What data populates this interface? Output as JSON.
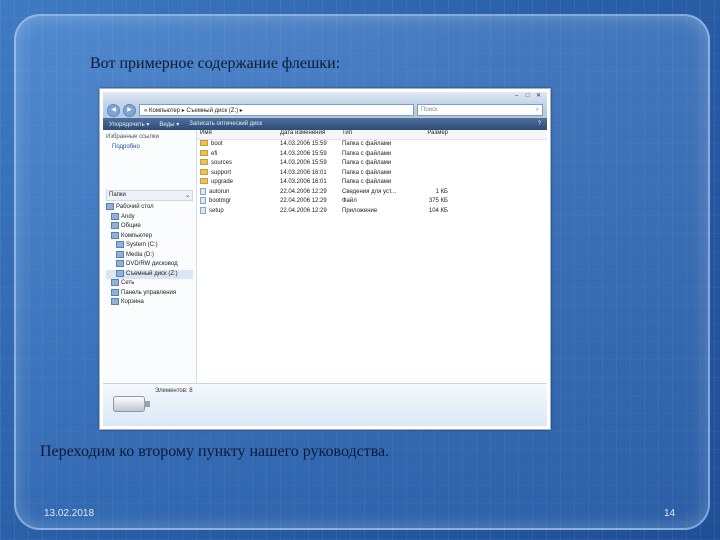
{
  "slide": {
    "title": "Вот примерное содержание флешки:",
    "caption": "Переходим ко второму пункту нашего руководства.",
    "date": "13.02.2018",
    "page": "14"
  },
  "window": {
    "address": "« Компьютер ▸ Съемный диск (Z:) ▸",
    "search_placeholder": "Поиск",
    "toolbar": [
      "Упорядочить ▾",
      "Виды ▾",
      "Записать оптический диск"
    ],
    "favorites_header": "Избранные ссылки",
    "favorites_more": "Подробно",
    "folders_header": "Папки",
    "tree": [
      {
        "label": "Рабочий стол",
        "selected": false
      },
      {
        "label": "Andy",
        "selected": false
      },
      {
        "label": "Общие",
        "selected": false
      },
      {
        "label": "Компьютер",
        "selected": false
      },
      {
        "label": "System (C:)",
        "selected": false
      },
      {
        "label": "Media (D:)",
        "selected": false
      },
      {
        "label": "DVD/RW дисковод",
        "selected": false
      },
      {
        "label": "Съемный диск (Z:)",
        "selected": true
      },
      {
        "label": "Сеть",
        "selected": false
      },
      {
        "label": "Панель управления",
        "selected": false
      },
      {
        "label": "Корзина",
        "selected": false
      }
    ],
    "columns": [
      "Имя",
      "Дата изменения",
      "Тип",
      "Размер"
    ],
    "files": [
      {
        "name": "boot",
        "date": "14.03.2006 15:59",
        "type": "Папка с файлами",
        "size": "",
        "folder": true
      },
      {
        "name": "efi",
        "date": "14.03.2006 15:59",
        "type": "Папка с файлами",
        "size": "",
        "folder": true
      },
      {
        "name": "sources",
        "date": "14.03.2006 15:59",
        "type": "Папка с файлами",
        "size": "",
        "folder": true
      },
      {
        "name": "support",
        "date": "14.03.2006 16:01",
        "type": "Папка с файлами",
        "size": "",
        "folder": true
      },
      {
        "name": "upgrade",
        "date": "14.03.2006 16:01",
        "type": "Папка с файлами",
        "size": "",
        "folder": true
      },
      {
        "name": "autorun",
        "date": "22.04.2006 12:29",
        "type": "Сведения для уст...",
        "size": "1 КБ",
        "folder": false
      },
      {
        "name": "bootmgr",
        "date": "22.04.2006 12:29",
        "type": "Файл",
        "size": "375 КБ",
        "folder": false
      },
      {
        "name": "setup",
        "date": "22.04.2006 12:29",
        "type": "Приложение",
        "size": "104 КБ",
        "folder": false
      }
    ],
    "details_text": "Элементов: 8"
  }
}
